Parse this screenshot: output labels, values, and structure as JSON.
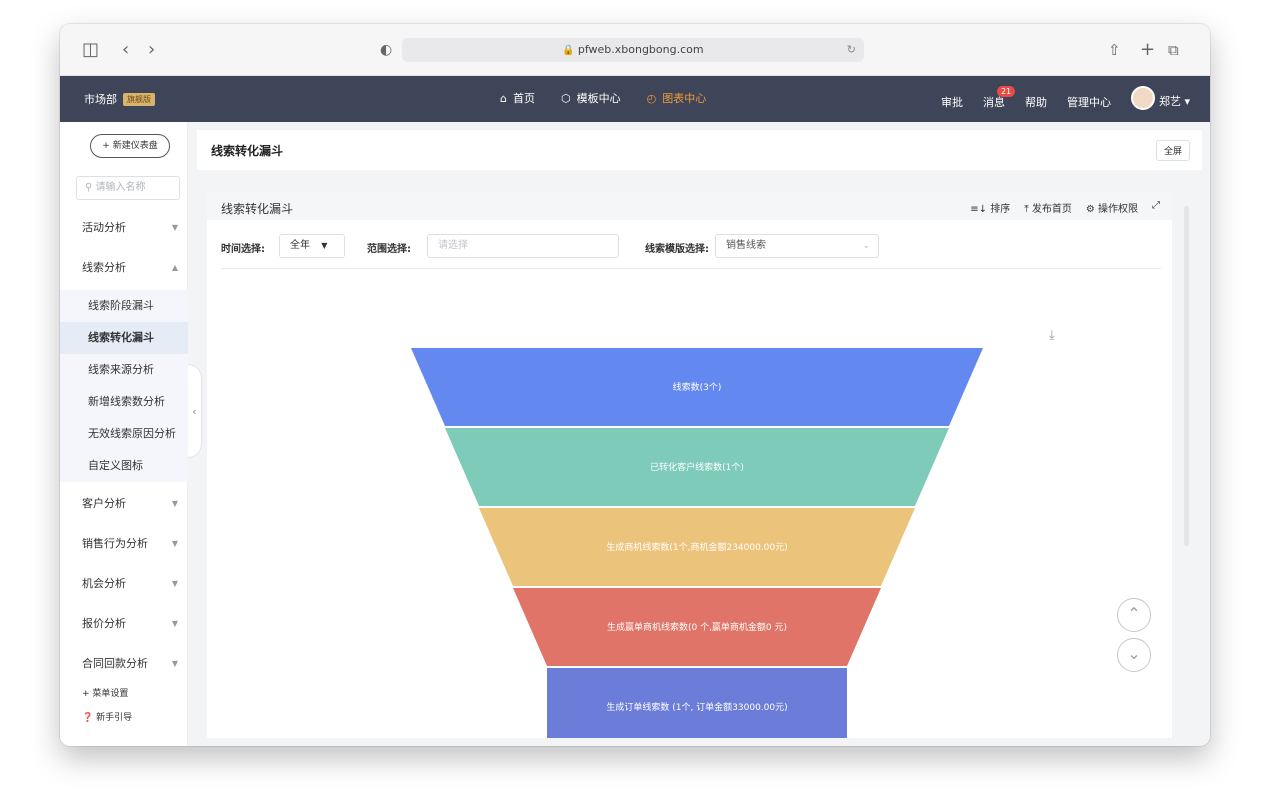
{
  "browser": {
    "url": "pfweb.xbongbong.com"
  },
  "topnav": {
    "org": "市场部",
    "edition_badge": "旗舰版",
    "nav_items": [
      {
        "label": "首页",
        "icon": "home-icon"
      },
      {
        "label": "模板中心",
        "icon": "cube-icon"
      },
      {
        "label": "图表中心",
        "icon": "pie-chart-icon"
      }
    ],
    "right_items": {
      "approval": "审批",
      "messages": "消息",
      "message_count": "21",
      "help": "帮助",
      "admin": "管理中心",
      "user": "郑艺"
    },
    "accent_color": "#f3993b"
  },
  "sidebar": {
    "new_dashboard": "+ 新建仪表盘",
    "search_placeholder": "请输入名称",
    "menu": [
      {
        "label": "活动分析"
      },
      {
        "label": "线索分析"
      },
      {
        "label": "客户分析"
      },
      {
        "label": "销售行为分析"
      },
      {
        "label": "机会分析"
      },
      {
        "label": "报价分析"
      },
      {
        "label": "合同回款分析"
      }
    ],
    "sub_items": [
      "线索阶段漏斗",
      "线索转化漏斗",
      "线索来源分析",
      "新增线索数分析",
      "无效线索原因分析",
      "自定义图标"
    ],
    "selected_sub": "线索转化漏斗",
    "footer": {
      "menu_settings": "+ 菜单设置",
      "guide": "新手引导"
    }
  },
  "header": {
    "title": "线索转化漏斗",
    "fullscreen": "全屏"
  },
  "card": {
    "title": "线索转化漏斗",
    "tools": {
      "sort": "排序",
      "publish": "发布首页",
      "permission": "操作权限"
    },
    "filters": {
      "time_label": "时间选择:",
      "time_value": "全年",
      "range_label": "范围选择:",
      "range_placeholder": "请选择",
      "template_label": "线索模版选择:",
      "template_value": "销售线索"
    }
  },
  "chart_data": {
    "type": "funnel",
    "stages": [
      {
        "label": "线索数(3个)",
        "color": "#6388ef"
      },
      {
        "label": "已转化客户线索数(1个)",
        "color": "#7ecbba"
      },
      {
        "label": "生成商机线索数(1个,商机金额234000.00元)",
        "color": "#ecc37b"
      },
      {
        "label": "生成赢单商机线索数(0 个,赢单商机金额0 元)",
        "color": "#e07468"
      },
      {
        "label": "生成订单线索数 (1个, 订单金额33000.00元)",
        "color": "#6c7dd9"
      }
    ]
  }
}
